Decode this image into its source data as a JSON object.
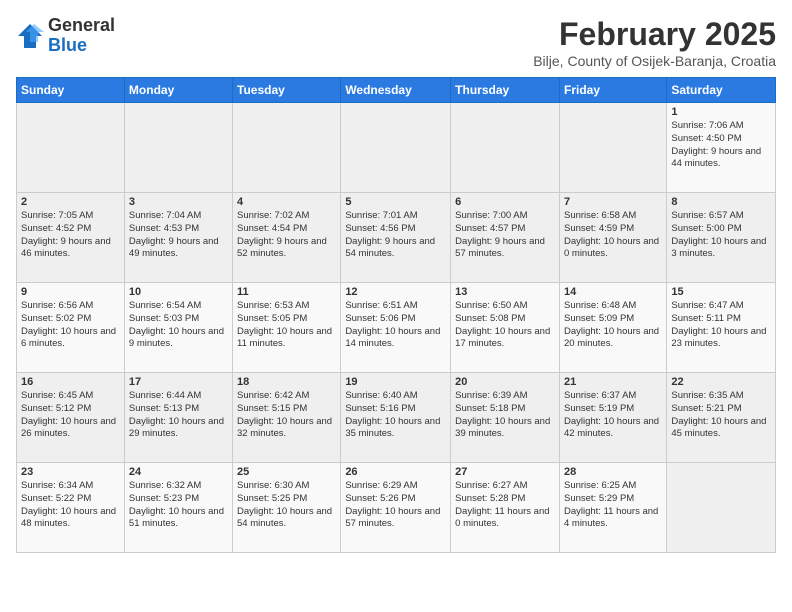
{
  "logo": {
    "general": "General",
    "blue": "Blue"
  },
  "header": {
    "month": "February 2025",
    "location": "Bilje, County of Osijek-Baranja, Croatia"
  },
  "weekdays": [
    "Sunday",
    "Monday",
    "Tuesday",
    "Wednesday",
    "Thursday",
    "Friday",
    "Saturday"
  ],
  "weeks": [
    [
      {
        "day": "",
        "info": ""
      },
      {
        "day": "",
        "info": ""
      },
      {
        "day": "",
        "info": ""
      },
      {
        "day": "",
        "info": ""
      },
      {
        "day": "",
        "info": ""
      },
      {
        "day": "",
        "info": ""
      },
      {
        "day": "1",
        "info": "Sunrise: 7:06 AM\nSunset: 4:50 PM\nDaylight: 9 hours and 44 minutes."
      }
    ],
    [
      {
        "day": "2",
        "info": "Sunrise: 7:05 AM\nSunset: 4:52 PM\nDaylight: 9 hours and 46 minutes."
      },
      {
        "day": "3",
        "info": "Sunrise: 7:04 AM\nSunset: 4:53 PM\nDaylight: 9 hours and 49 minutes."
      },
      {
        "day": "4",
        "info": "Sunrise: 7:02 AM\nSunset: 4:54 PM\nDaylight: 9 hours and 52 minutes."
      },
      {
        "day": "5",
        "info": "Sunrise: 7:01 AM\nSunset: 4:56 PM\nDaylight: 9 hours and 54 minutes."
      },
      {
        "day": "6",
        "info": "Sunrise: 7:00 AM\nSunset: 4:57 PM\nDaylight: 9 hours and 57 minutes."
      },
      {
        "day": "7",
        "info": "Sunrise: 6:58 AM\nSunset: 4:59 PM\nDaylight: 10 hours and 0 minutes."
      },
      {
        "day": "8",
        "info": "Sunrise: 6:57 AM\nSunset: 5:00 PM\nDaylight: 10 hours and 3 minutes."
      }
    ],
    [
      {
        "day": "9",
        "info": "Sunrise: 6:56 AM\nSunset: 5:02 PM\nDaylight: 10 hours and 6 minutes."
      },
      {
        "day": "10",
        "info": "Sunrise: 6:54 AM\nSunset: 5:03 PM\nDaylight: 10 hours and 9 minutes."
      },
      {
        "day": "11",
        "info": "Sunrise: 6:53 AM\nSunset: 5:05 PM\nDaylight: 10 hours and 11 minutes."
      },
      {
        "day": "12",
        "info": "Sunrise: 6:51 AM\nSunset: 5:06 PM\nDaylight: 10 hours and 14 minutes."
      },
      {
        "day": "13",
        "info": "Sunrise: 6:50 AM\nSunset: 5:08 PM\nDaylight: 10 hours and 17 minutes."
      },
      {
        "day": "14",
        "info": "Sunrise: 6:48 AM\nSunset: 5:09 PM\nDaylight: 10 hours and 20 minutes."
      },
      {
        "day": "15",
        "info": "Sunrise: 6:47 AM\nSunset: 5:11 PM\nDaylight: 10 hours and 23 minutes."
      }
    ],
    [
      {
        "day": "16",
        "info": "Sunrise: 6:45 AM\nSunset: 5:12 PM\nDaylight: 10 hours and 26 minutes."
      },
      {
        "day": "17",
        "info": "Sunrise: 6:44 AM\nSunset: 5:13 PM\nDaylight: 10 hours and 29 minutes."
      },
      {
        "day": "18",
        "info": "Sunrise: 6:42 AM\nSunset: 5:15 PM\nDaylight: 10 hours and 32 minutes."
      },
      {
        "day": "19",
        "info": "Sunrise: 6:40 AM\nSunset: 5:16 PM\nDaylight: 10 hours and 35 minutes."
      },
      {
        "day": "20",
        "info": "Sunrise: 6:39 AM\nSunset: 5:18 PM\nDaylight: 10 hours and 39 minutes."
      },
      {
        "day": "21",
        "info": "Sunrise: 6:37 AM\nSunset: 5:19 PM\nDaylight: 10 hours and 42 minutes."
      },
      {
        "day": "22",
        "info": "Sunrise: 6:35 AM\nSunset: 5:21 PM\nDaylight: 10 hours and 45 minutes."
      }
    ],
    [
      {
        "day": "23",
        "info": "Sunrise: 6:34 AM\nSunset: 5:22 PM\nDaylight: 10 hours and 48 minutes."
      },
      {
        "day": "24",
        "info": "Sunrise: 6:32 AM\nSunset: 5:23 PM\nDaylight: 10 hours and 51 minutes."
      },
      {
        "day": "25",
        "info": "Sunrise: 6:30 AM\nSunset: 5:25 PM\nDaylight: 10 hours and 54 minutes."
      },
      {
        "day": "26",
        "info": "Sunrise: 6:29 AM\nSunset: 5:26 PM\nDaylight: 10 hours and 57 minutes."
      },
      {
        "day": "27",
        "info": "Sunrise: 6:27 AM\nSunset: 5:28 PM\nDaylight: 11 hours and 0 minutes."
      },
      {
        "day": "28",
        "info": "Sunrise: 6:25 AM\nSunset: 5:29 PM\nDaylight: 11 hours and 4 minutes."
      },
      {
        "day": "",
        "info": ""
      }
    ]
  ]
}
